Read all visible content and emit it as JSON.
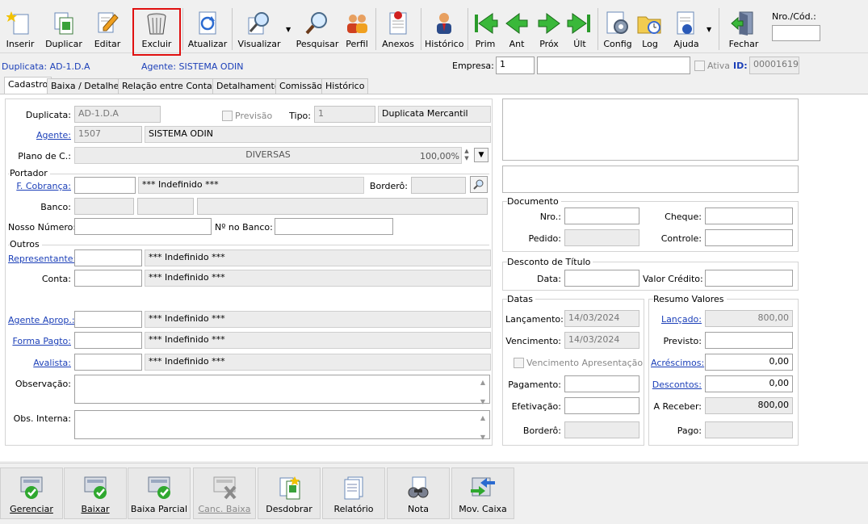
{
  "toolbar": {
    "inserir": "Inserir",
    "duplicar": "Duplicar",
    "editar": "Editar",
    "excluir": "Excluir",
    "atualizar": "Atualizar",
    "visualizar": "Visualizar",
    "pesquisar": "Pesquisar",
    "perfil": "Perfil",
    "anexos": "Anexos",
    "historico": "Histórico",
    "prim": "Prim",
    "ant": "Ant",
    "prox": "Próx",
    "ult": "Últ",
    "config": "Config",
    "log": "Log",
    "ajuda": "Ajuda",
    "fechar": "Fechar",
    "nro_cod_label": "Nro./Cód.:",
    "nro_cod_value": ""
  },
  "header": {
    "duplicata_text": "Duplicata: AD-1.D.A",
    "agente_text": "Agente: SISTEMA ODIN",
    "empresa_label": "Empresa:",
    "empresa_value": "1",
    "empresa_name": "",
    "ativa_label": "Ativa",
    "id_label": "ID:",
    "id_value": "00001619"
  },
  "tabs": [
    "Cadastro",
    "Baixa / Detalhes",
    "Relação entre Contas",
    "Detalhamento",
    "Comissão",
    "Histórico"
  ],
  "form": {
    "duplicata_label": "Duplicata:",
    "duplicata_value": "AD-1.D.A",
    "previsao_label": "Previsão",
    "tipo_label": "Tipo:",
    "tipo_code": "1",
    "tipo_name": "Duplicata Mercantil",
    "agente_label": "Agente:",
    "agente_code": "1507",
    "agente_name": "SISTEMA ODIN",
    "plano_label": "Plano de C.:",
    "plano_value": "DIVERSAS",
    "plano_pct": "100,00%",
    "portador_title": "Portador",
    "fcobranca_label": "F. Cobrança:",
    "fcobranca_code": "",
    "fcobranca_name": "*** Indefinido ***",
    "bordero_label": "Borderô:",
    "bordero_value": "",
    "banco_label": "Banco:",
    "nosso_numero_label": "Nosso Número:",
    "nosso_numero_value": "",
    "no_banco_label": "Nº no Banco:",
    "no_banco_value": "",
    "outros_title": "Outros",
    "representante_label": "Representante:",
    "representante_code": "",
    "representante_name": "*** Indefinido ***",
    "conta_label": "Conta:",
    "conta_code": "",
    "conta_name": "*** Indefinido ***",
    "agente_aprop_label": "Agente Aprop.:",
    "agente_aprop_code": "",
    "agente_aprop_name": "*** Indefinido ***",
    "forma_pagto_label": "Forma Pagto:",
    "forma_pagto_code": "",
    "forma_pagto_name": "*** Indefinido ***",
    "avalista_label": "Avalista:",
    "avalista_code": "",
    "avalista_name": "*** Indefinido ***",
    "observacao_label": "Observação:",
    "observacao_value": "",
    "obs_interna_label": "Obs. Interna:",
    "obs_interna_value": ""
  },
  "documento": {
    "title": "Documento",
    "nro_label": "Nro.:",
    "nro_value": "",
    "cheque_label": "Cheque:",
    "cheque_value": "",
    "pedido_label": "Pedido:",
    "pedido_value": "",
    "controle_label": "Controle:",
    "controle_value": ""
  },
  "desconto": {
    "title": "Desconto de Título",
    "data_label": "Data:",
    "data_value": "",
    "valor_credito_label": "Valor Crédito:",
    "valor_credito_value": ""
  },
  "datas": {
    "title": "Datas",
    "lancamento_label": "Lançamento:",
    "lancamento_value": "14/03/2024",
    "vencimento_label": "Vencimento:",
    "vencimento_value": "14/03/2024",
    "venc_apresentacao_label": "Vencimento Apresentação",
    "pagamento_label": "Pagamento:",
    "pagamento_value": "",
    "efetivacao_label": "Efetivação:",
    "efetivacao_value": "",
    "bordero_label": "Borderô:",
    "bordero_value": ""
  },
  "resumo": {
    "title": "Resumo Valores",
    "lancado_label": "Lançado:",
    "lancado_value": "800,00",
    "previsto_label": "Previsto:",
    "previsto_value": "",
    "acrescimos_label": "Acréscimos:",
    "acrescimos_value": "0,00",
    "descontos_label": "Descontos:",
    "descontos_value": "0,00",
    "a_receber_label": "A Receber:",
    "a_receber_value": "800,00",
    "pago_label": "Pago:",
    "pago_value": ""
  },
  "bottom": {
    "gerenciar": "Gerenciar",
    "baixar": "Baixar",
    "baixa_parcial": "Baixa Parcial",
    "canc_baixa": "Canc. Baixa",
    "desdobrar": "Desdobrar",
    "relatorio": "Relatório",
    "nota": "Nota",
    "mov_caixa": "Mov. Caixa"
  },
  "colors": {
    "link": "#1b3fb8",
    "highlight": "#e01010",
    "green_check": "#2fa82f"
  }
}
